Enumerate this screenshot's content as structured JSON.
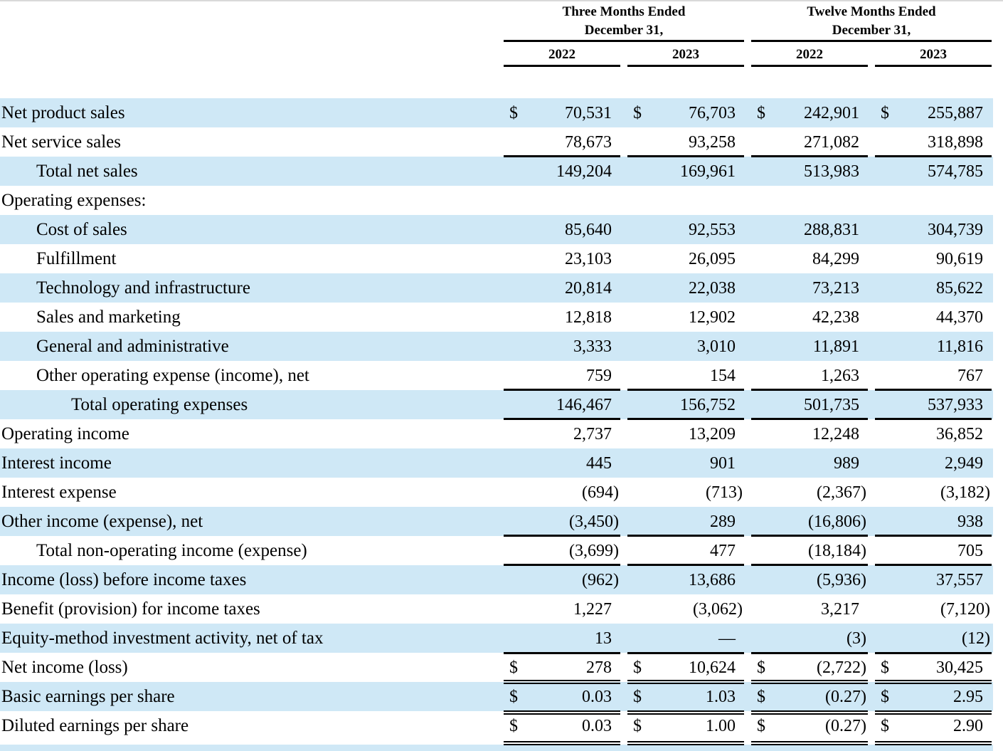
{
  "header": {
    "group1": [
      "Three Months Ended",
      "December 31,"
    ],
    "group2": [
      "Twelve Months Ended",
      "December 31,"
    ],
    "years": [
      "2022",
      "2023",
      "2022",
      "2023"
    ]
  },
  "rows": [
    {
      "label": "Net product sales",
      "indent": 0,
      "shade": true,
      "dollar": true,
      "values": [
        "70,531",
        "76,703",
        "242,901",
        "255,887"
      ]
    },
    {
      "label": "Net service sales",
      "indent": 0,
      "shade": false,
      "values": [
        "78,673",
        "93,258",
        "271,082",
        "318,898"
      ]
    },
    {
      "label": "Total net sales",
      "indent": 1,
      "shade": true,
      "values": [
        "149,204",
        "169,961",
        "513,983",
        "574,785"
      ]
    },
    {
      "label": "Operating expenses:",
      "indent": 0,
      "shade": false,
      "values": [
        "",
        "",
        "",
        ""
      ]
    },
    {
      "label": "Cost of sales",
      "indent": 1,
      "shade": true,
      "values": [
        "85,640",
        "92,553",
        "288,831",
        "304,739"
      ]
    },
    {
      "label": "Fulfillment",
      "indent": 1,
      "shade": false,
      "values": [
        "23,103",
        "26,095",
        "84,299",
        "90,619"
      ]
    },
    {
      "label": "Technology and infrastructure",
      "indent": 1,
      "shade": true,
      "values": [
        "20,814",
        "22,038",
        "73,213",
        "85,622"
      ]
    },
    {
      "label": "Sales and marketing",
      "indent": 1,
      "shade": false,
      "values": [
        "12,818",
        "12,902",
        "42,238",
        "44,370"
      ]
    },
    {
      "label": "General and administrative",
      "indent": 1,
      "shade": true,
      "values": [
        "3,333",
        "3,010",
        "11,891",
        "11,816"
      ]
    },
    {
      "label": "Other operating expense (income), net",
      "indent": 1,
      "shade": false,
      "values": [
        "759",
        "154",
        "1,263",
        "767"
      ]
    },
    {
      "label": "Total operating expenses",
      "indent": 2,
      "shade": true,
      "values": [
        "146,467",
        "156,752",
        "501,735",
        "537,933"
      ]
    },
    {
      "label": "Operating income",
      "indent": 0,
      "shade": false,
      "values": [
        "2,737",
        "13,209",
        "12,248",
        "36,852"
      ]
    },
    {
      "label": "Interest income",
      "indent": 0,
      "shade": true,
      "values": [
        "445",
        "901",
        "989",
        "2,949"
      ]
    },
    {
      "label": "Interest expense",
      "indent": 0,
      "shade": false,
      "values": [
        "(694)",
        "(713)",
        "(2,367)",
        "(3,182)"
      ]
    },
    {
      "label": "Other income (expense), net",
      "indent": 0,
      "shade": true,
      "values": [
        "(3,450)",
        "289",
        "(16,806)",
        "938"
      ]
    },
    {
      "label": "Total non-operating income (expense)",
      "indent": 1,
      "shade": false,
      "values": [
        "(3,699)",
        "477",
        "(18,184)",
        "705"
      ]
    },
    {
      "label": "Income (loss) before income taxes",
      "indent": 0,
      "shade": true,
      "values": [
        "(962)",
        "13,686",
        "(5,936)",
        "37,557"
      ]
    },
    {
      "label": "Benefit (provision) for income taxes",
      "indent": 0,
      "shade": false,
      "values": [
        "1,227",
        "(3,062)",
        "3,217",
        "(7,120)"
      ]
    },
    {
      "label": "Equity-method investment activity, net of tax",
      "indent": 0,
      "shade": true,
      "values": [
        "13",
        "—",
        "(3)",
        "(12)"
      ]
    },
    {
      "label": "Net income (loss)",
      "indent": 0,
      "shade": false,
      "dollar": true,
      "values": [
        "278",
        "10,624",
        "(2,722)",
        "30,425"
      ]
    },
    {
      "label": "Basic earnings per share",
      "indent": 0,
      "shade": true,
      "dollar": true,
      "values": [
        "0.03",
        "1.03",
        "(0.27)",
        "2.95"
      ]
    },
    {
      "label": "Diluted earnings per share",
      "indent": 0,
      "shade": false,
      "dollar": true,
      "values": [
        "0.03",
        "1.00",
        "(0.27)",
        "2.90"
      ]
    }
  ],
  "currency_symbol": "$",
  "colors": {
    "shade": "#cfe8f6",
    "text": "#000000"
  }
}
